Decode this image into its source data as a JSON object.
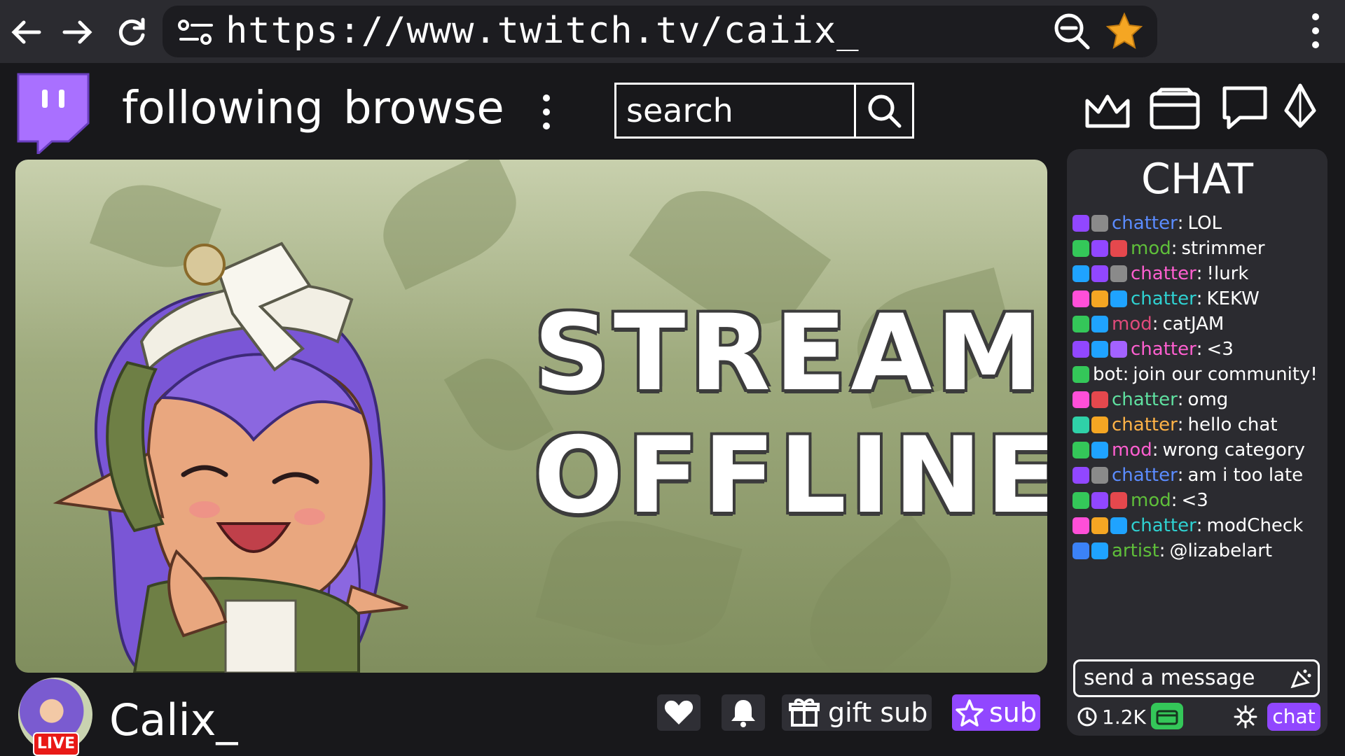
{
  "browser": {
    "url": "https://www.twitch.tv/caiix_",
    "back_icon": "arrow-left-icon",
    "forward_icon": "arrow-right-icon",
    "reload_icon": "reload-icon",
    "site_info_icon": "site-settings-icon",
    "zoom_icon": "zoom-out-icon",
    "bookmark_icon": "star-icon",
    "menu_icon": "kebab-menu-icon"
  },
  "nav": {
    "logo": "twitch-logo",
    "following_label": "following",
    "browse_label": "browse",
    "more_icon": "kebab-menu-icon",
    "search_placeholder": "search",
    "search_icon": "search-icon",
    "right_icons": [
      "crown-icon",
      "inbox-icon",
      "whisper-icon",
      "bits-icon"
    ]
  },
  "stream": {
    "offline_line1": "STREAM",
    "offline_line2": "OFFLINE"
  },
  "chat": {
    "title": "CHAT",
    "messages": [
      {
        "badges": [
          "#9147ff",
          "#8a8a8a"
        ],
        "user": "chatter",
        "user_color": "#5b8cff",
        "text": "LOL"
      },
      {
        "badges": [
          "#34c759",
          "#9147ff",
          "#e5484d"
        ],
        "user": "mod",
        "user_color": "#5fbf3a",
        "text": "strimmer"
      },
      {
        "badges": [
          "#1fa3ff",
          "#9147ff",
          "#8a8a8a"
        ],
        "user": "chatter",
        "user_color": "#ff5fd0",
        "text": "!lurk"
      },
      {
        "badges": [
          "#ff4fd8",
          "#f5a623",
          "#1fa3ff"
        ],
        "user": "chatter",
        "user_color": "#2fd1d1",
        "text": "KEKW"
      },
      {
        "badges": [
          "#34c759",
          "#1fa3ff"
        ],
        "user": "mod",
        "user_color": "#e04a7a",
        "text": "catJAM"
      },
      {
        "badges": [
          "#9147ff",
          "#1fa3ff",
          "#a362ff"
        ],
        "user": "chatter",
        "user_color": "#ff5fd0",
        "text": "<3"
      },
      {
        "badges": [
          "#34c759"
        ],
        "user": "bot",
        "user_color": "#ffffff",
        "text": "join our community!"
      },
      {
        "badges": [
          "#ff4fd8",
          "#e5484d"
        ],
        "user": "chatter",
        "user_color": "#5fe0a0",
        "text": "omg"
      },
      {
        "badges": [
          "#2fd1a8",
          "#f5a623"
        ],
        "user": "chatter",
        "user_color": "#ffb347",
        "text": "hello chat"
      },
      {
        "badges": [
          "#34c759",
          "#1fa3ff"
        ],
        "user": "mod",
        "user_color": "#ff5fd0",
        "text": "wrong category"
      },
      {
        "badges": [
          "#9147ff",
          "#8a8a8a"
        ],
        "user": "chatter",
        "user_color": "#5b8cff",
        "text": "am i too late"
      },
      {
        "badges": [
          "#34c759",
          "#9147ff",
          "#e5484d"
        ],
        "user": "mod",
        "user_color": "#5fbf3a",
        "text": "<3"
      },
      {
        "badges": [
          "#ff4fd8",
          "#f5a623",
          "#1fa3ff"
        ],
        "user": "chatter",
        "user_color": "#2fd1d1",
        "text": "modCheck"
      },
      {
        "badges": [
          "#3b82f6",
          "#1fa3ff"
        ],
        "user": "artist",
        "user_color": "#5fbf3a",
        "text": "@lizabelart"
      }
    ],
    "input_placeholder": "send a message",
    "emote_icon": "emote-icon",
    "viewer_count": "1.2K",
    "points_icon": "channel-points-icon",
    "settings_icon": "gear-icon",
    "chat_button": "chat"
  },
  "channel": {
    "name": "Calix_",
    "live_label": "LIVE",
    "follow_icon": "heart-icon",
    "notify_icon": "bell-icon",
    "gift_sub_label": "gift sub",
    "gift_icon": "gift-icon",
    "sub_label": "sub",
    "sub_icon": "star-icon"
  },
  "colors": {
    "accent": "#9147ff",
    "background": "#18181b",
    "panel": "#2b2b30",
    "live": "#e91916"
  }
}
